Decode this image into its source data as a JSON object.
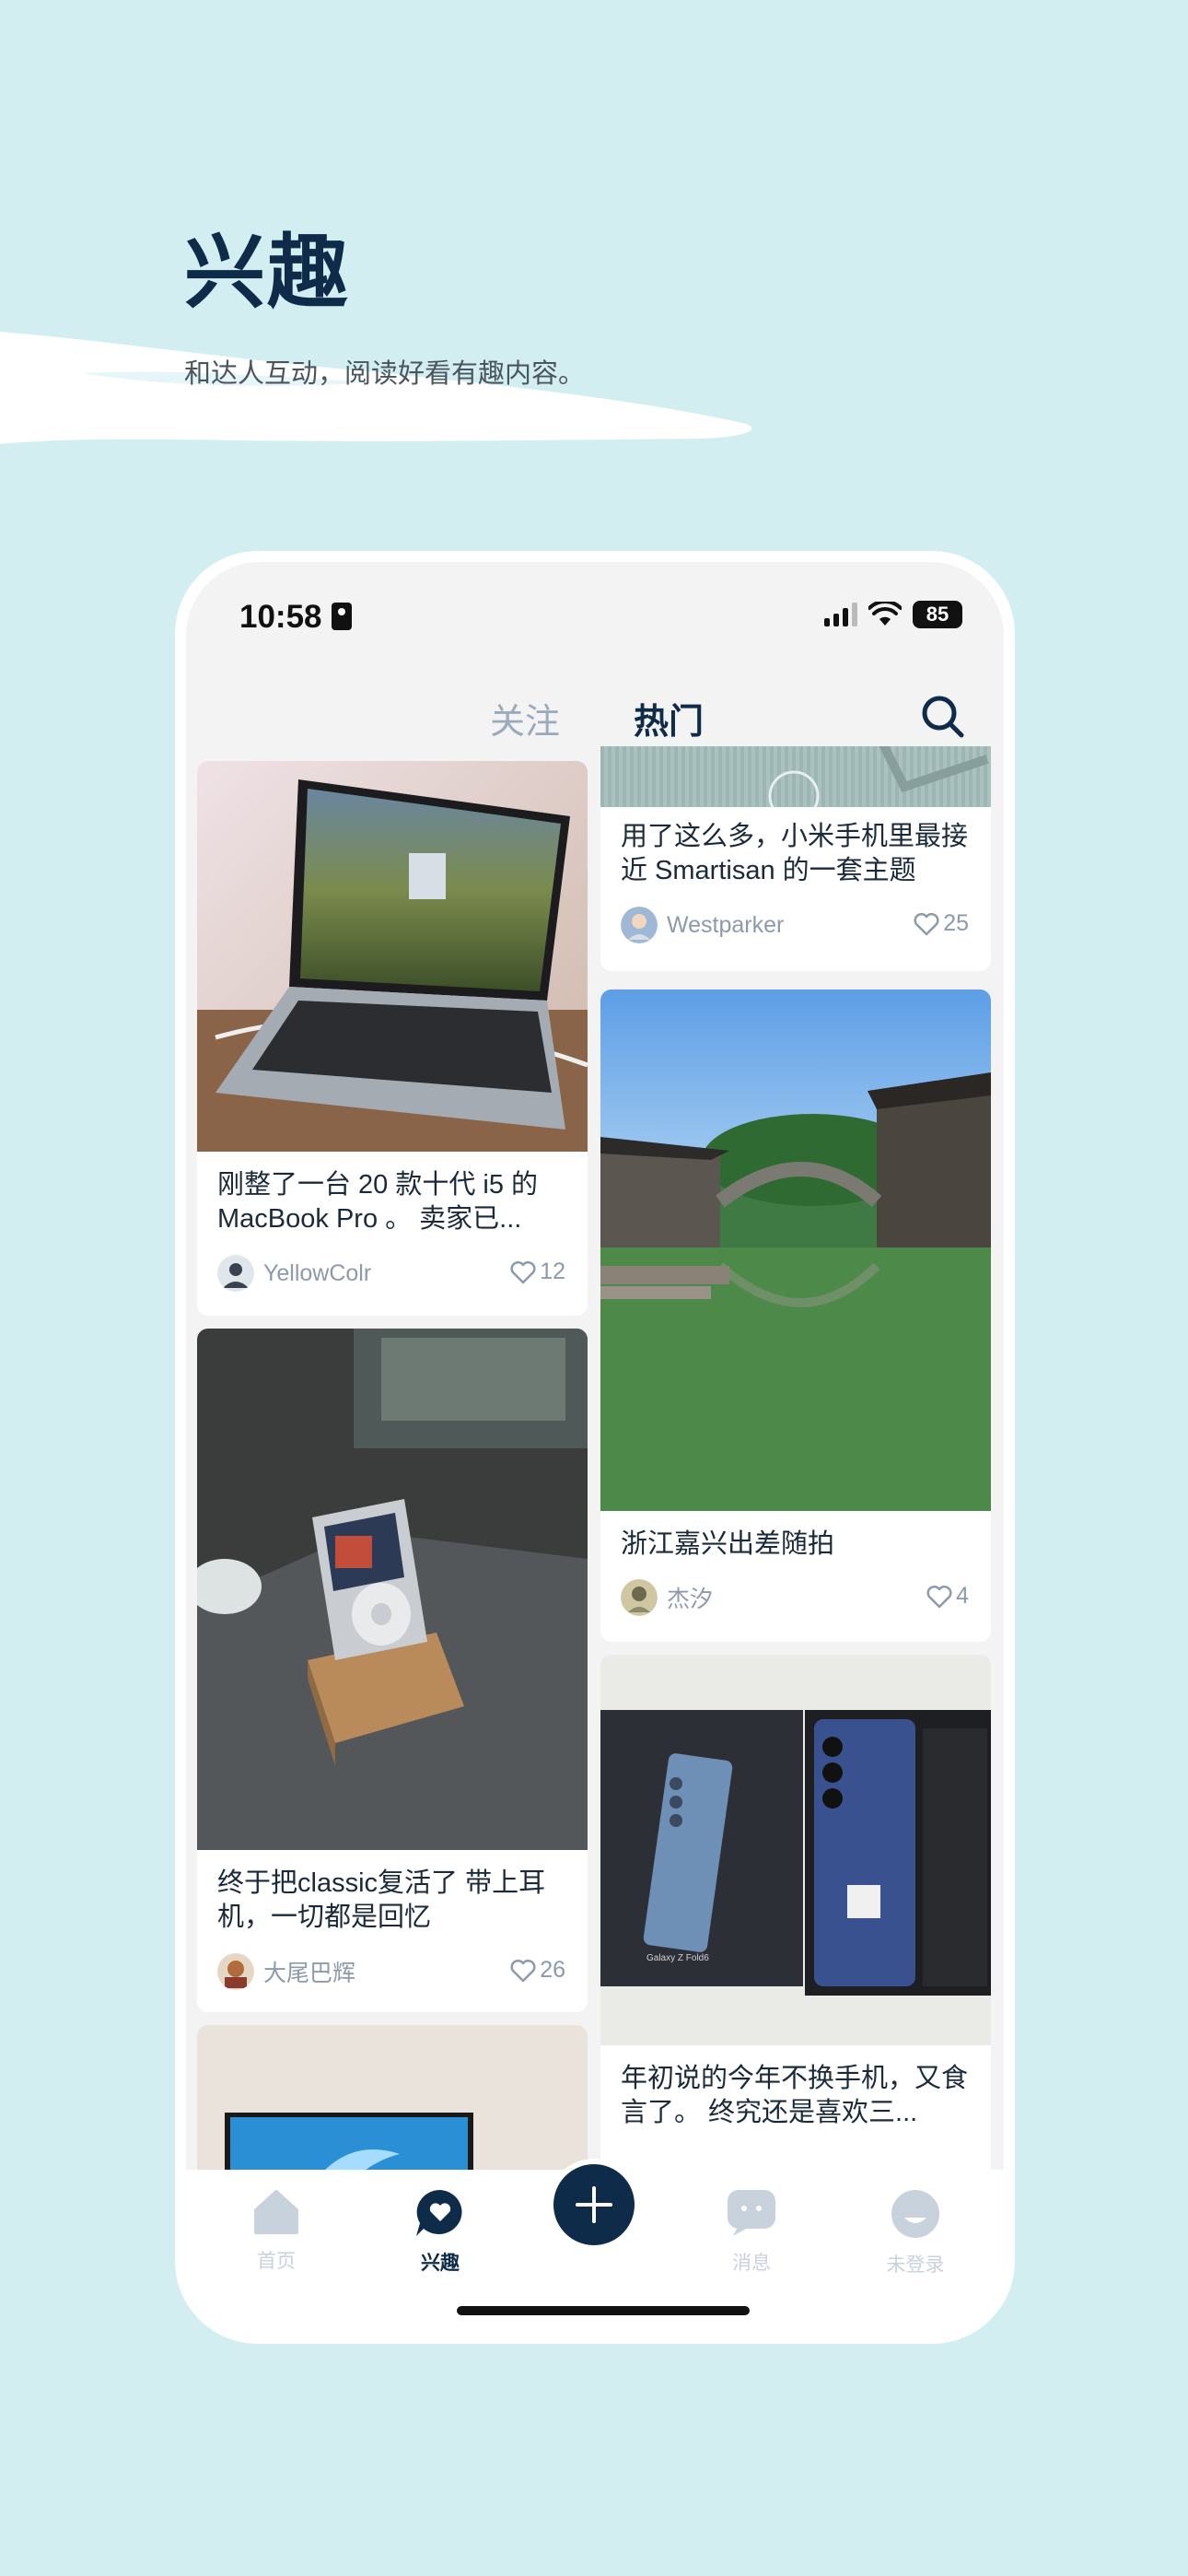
{
  "hero": {
    "title": "兴趣",
    "subtitle": "和达人互动，阅读好看有趣内容。"
  },
  "status_bar": {
    "time": "10:58",
    "battery": "85",
    "icons": [
      "person-card-icon",
      "signal-icon",
      "wifi-icon",
      "battery-icon"
    ]
  },
  "tabs": {
    "follow": "关注",
    "hot": "热门",
    "search_icon": "search-icon"
  },
  "feed": {
    "left": [
      {
        "title": "刚整了一台 20 款十代 i5 的 MacBook Pro 。 卖家已...",
        "author": "YellowColr",
        "likes": "12",
        "image": "macbook-photo"
      },
      {
        "title": "终于把classic复活了 带上耳机，一切都是回忆",
        "author": "大尾巴辉",
        "likes": "26",
        "image": "ipod-classic-photo"
      },
      {
        "title": "",
        "author": "",
        "likes": "",
        "image": "laptop-windows-photo"
      }
    ],
    "right": [
      {
        "title": "用了这么多，小米手机里最接近 Smartisan 的一套主题",
        "author": "Westparker",
        "likes": "25",
        "image": "theme-screenshot"
      },
      {
        "title": "浙江嘉兴出差随拍",
        "author": "杰汐",
        "likes": "4",
        "image": "water-town-photo"
      },
      {
        "title": "年初说的今年不换手机，又食言了。 终究还是喜欢三...",
        "author": "",
        "likes": "",
        "image": "galaxy-z-fold6-photo",
        "box_text": "Galaxy Z Fold6"
      }
    ]
  },
  "bottom_nav": {
    "home": "首页",
    "interest": "兴趣",
    "messages": "消息",
    "profile": "未登录"
  },
  "colors": {
    "background": "#d3eef0",
    "brand_dark": "#0f2b4a",
    "muted": "#8c9aab"
  }
}
